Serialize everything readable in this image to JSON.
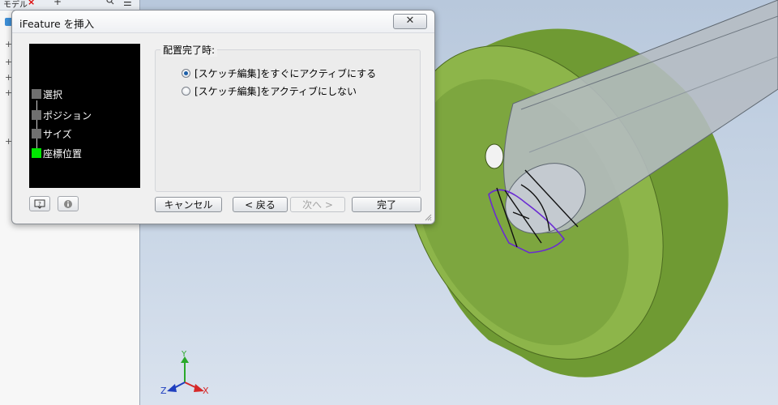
{
  "browser": {
    "tab_label": "モデル",
    "tab_close": "×",
    "tab_add": "+",
    "menu_icon": "hamburger-icon",
    "search_icon": "search-icon",
    "tree_markers": [
      "+",
      "+",
      "+",
      "+",
      "+"
    ]
  },
  "dialog": {
    "title": "iFeature を挿入",
    "close_label": "✕",
    "steps": [
      {
        "label": "選択",
        "active": false
      },
      {
        "label": "ポジション",
        "active": false
      },
      {
        "label": "サイズ",
        "active": false
      },
      {
        "label": "座標位置",
        "active": true
      }
    ],
    "group_title": "配置完了時:",
    "options": [
      {
        "label": "[スケッチ編集]をすぐにアクティブにする",
        "checked": true
      },
      {
        "label": "[スケッチ編集]をアクティブにしない",
        "checked": false
      }
    ],
    "buttons": {
      "cancel": "キャンセル",
      "back": "< 戻る",
      "next": "次へ >",
      "finish": "完了"
    },
    "help_icon": "help-icon",
    "info_icon": "info-icon"
  },
  "viewport": {
    "axis_labels": {
      "x": "X",
      "y": "Y",
      "z": "Z"
    },
    "colors": {
      "disk": "#8db54a",
      "disk_shadow": "#6f9a33",
      "shaft": "#b5bcc3",
      "sketch": "#6a2bd2"
    }
  }
}
